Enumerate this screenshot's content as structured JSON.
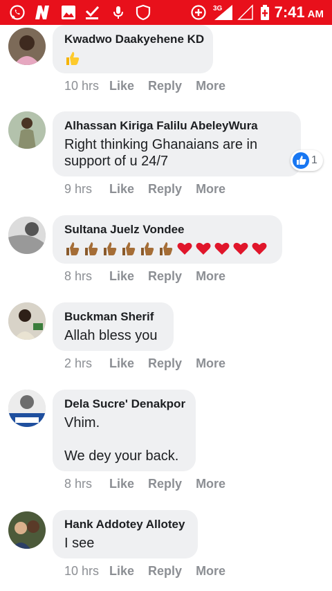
{
  "status_bar": {
    "network_label": "3G",
    "time": "7:41",
    "ampm": "AM",
    "background": "#e8101b",
    "icons": [
      "whatsapp-icon",
      "n-app-icon",
      "image-icon",
      "check-download-icon",
      "mic-icon",
      "shield-icon",
      "data-saver-icon",
      "signal-icon",
      "sim-signal-icon",
      "battery-icon"
    ]
  },
  "accent_text": "#1c1e21",
  "muted_text": "#8c8f94",
  "bubble_color": "#eff0f2",
  "comments": [
    {
      "author": "Kwadwo Daakyehene KD",
      "text": "",
      "emoji": "thumbs-up",
      "time": "10 hrs",
      "like": "Like",
      "reply": "Reply",
      "more": "More"
    },
    {
      "author": "Alhassan Kiriga Falilu AbeleyWura",
      "text": "Right thinking Ghanaians are in support of u 24/7",
      "time": "9 hrs",
      "like": "Like",
      "reply": "Reply",
      "more": "More",
      "reaction_count": "1"
    },
    {
      "author": "Sultana Juelz Vondee",
      "text": "",
      "emoji": "6 thumbs-up, 5 hearts",
      "time": "8 hrs",
      "like": "Like",
      "reply": "Reply",
      "more": "More"
    },
    {
      "author": "Buckman Sherif",
      "text": "Allah bless you",
      "time": "2 hrs",
      "like": "Like",
      "reply": "Reply",
      "more": "More"
    },
    {
      "author": "Dela Sucre' Denakpor",
      "text": "Vhim.",
      "text2": "We dey your back.",
      "time": "8 hrs",
      "like": "Like",
      "reply": "Reply",
      "more": "More"
    },
    {
      "author": "Hank Addotey Allotey",
      "text": "I see",
      "time": "10 hrs",
      "like": "Like",
      "reply": "Reply",
      "more": "More"
    }
  ]
}
